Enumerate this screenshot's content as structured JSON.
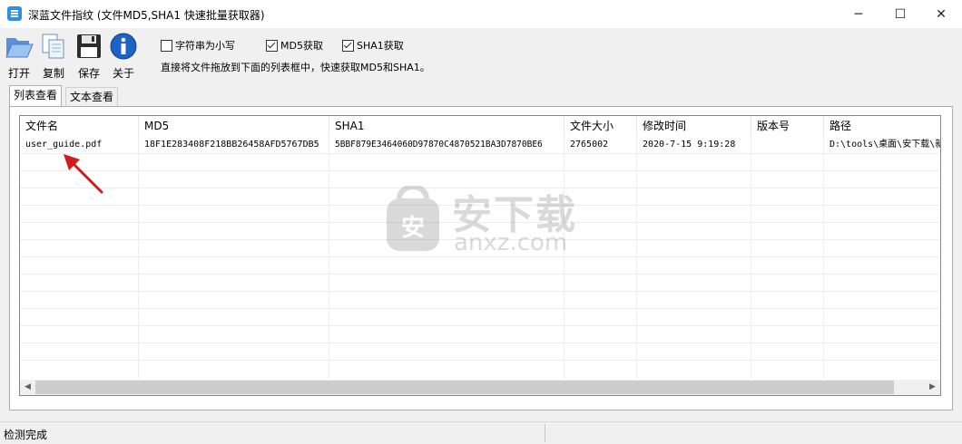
{
  "window": {
    "title": "深蓝文件指纹 (文件MD5,SHA1 快速批量获取器)",
    "minimize_glyph": "─",
    "maximize_glyph": "☐",
    "close_glyph": "✕"
  },
  "toolbar": {
    "open_label": "打开",
    "copy_label": "复制",
    "save_label": "保存",
    "about_label": "关于",
    "options": [
      {
        "label": "字符串为小写",
        "checked": false
      },
      {
        "label": "MD5获取",
        "checked": true
      },
      {
        "label": "SHA1获取",
        "checked": true
      }
    ],
    "hint": "直接将文件拖放到下面的列表框中，快速获取MD5和SHA1。"
  },
  "tabs": [
    {
      "label": "列表查看",
      "active": true
    },
    {
      "label": "文本查看",
      "active": false
    }
  ],
  "table": {
    "columns": [
      "文件名",
      "MD5",
      "SHA1",
      "文件大小",
      "修改时间",
      "版本号",
      "路径"
    ],
    "rows": [
      [
        "user_guide.pdf",
        "18F1E283408F218BB26458AFD5767DB5",
        "5BBF879E3464060D97870C4870521BA3D7870BE6",
        "2765002",
        "2020-7-15 9:19:28",
        "",
        "D:\\tools\\桌面\\安下载\\新"
      ]
    ]
  },
  "watermark": {
    "brand": "安下载",
    "domain": "anxz.com",
    "glyph": "安"
  },
  "status": {
    "text": "检测完成"
  },
  "colors": {
    "arrow": "#d01c1c",
    "accent": "#2f8ee8"
  }
}
